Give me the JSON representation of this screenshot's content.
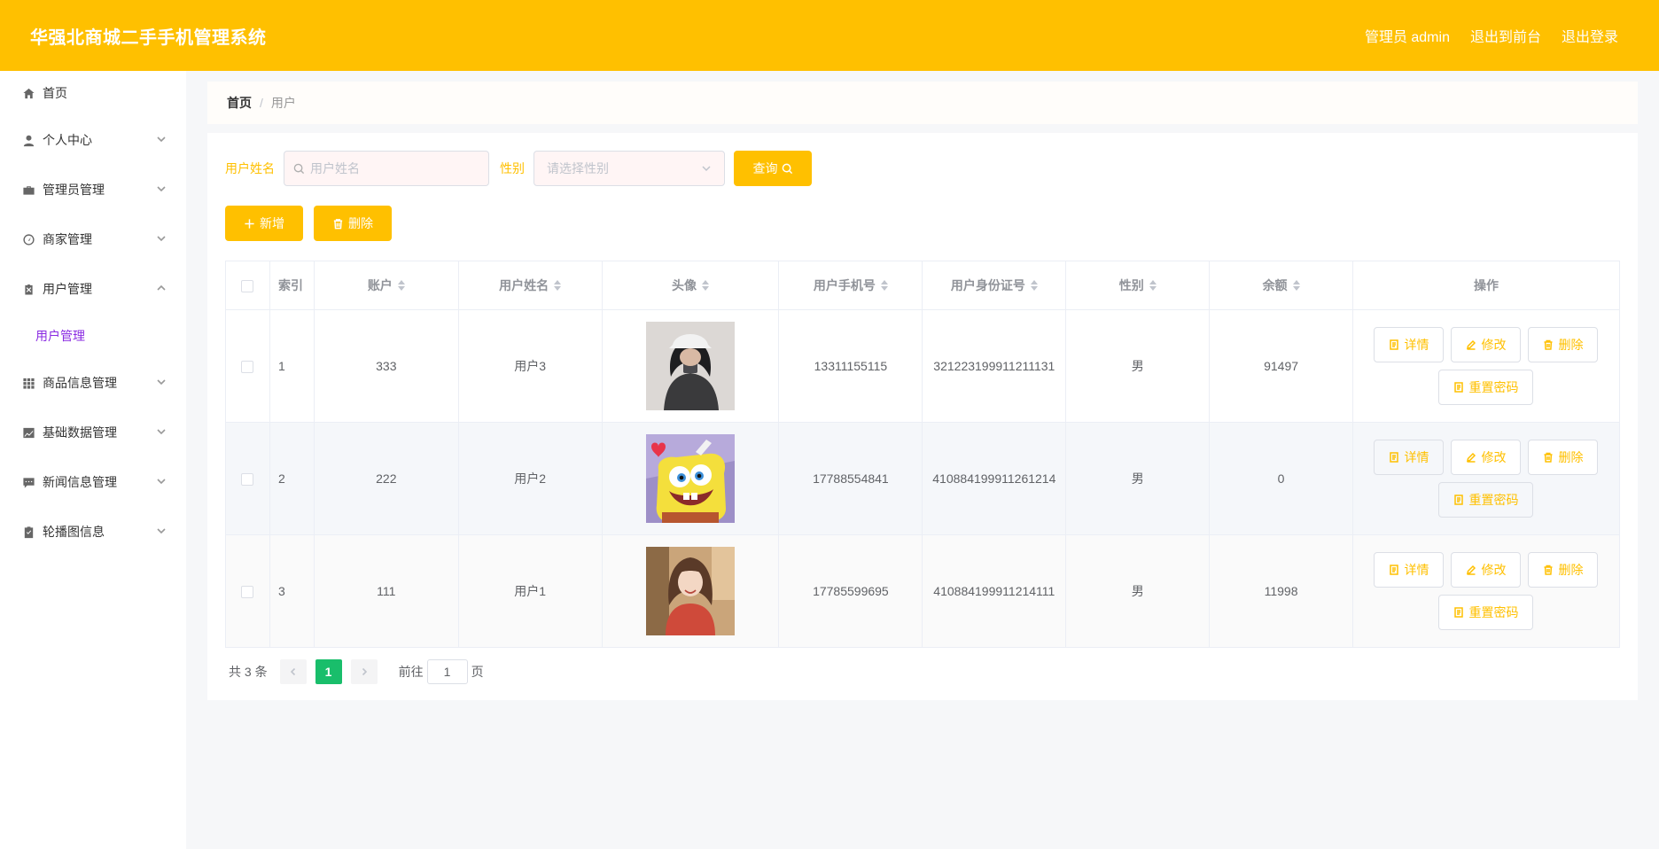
{
  "header": {
    "title": "华强北商城二手手机管理系统",
    "admin_label": "管理员 admin",
    "to_front_label": "退出到前台",
    "logout_label": "退出登录",
    "bg_color": "#ffc000"
  },
  "sidebar": {
    "items": [
      {
        "label": "首页",
        "icon": "home-icon"
      },
      {
        "label": "个人中心",
        "icon": "person-icon"
      },
      {
        "label": "管理员管理",
        "icon": "briefcase-icon"
      },
      {
        "label": "商家管理",
        "icon": "dashboard-icon"
      },
      {
        "label": "用户管理",
        "icon": "clipboard-icon",
        "expanded": true
      },
      {
        "label": "商品信息管理",
        "icon": "grid-icon"
      },
      {
        "label": "基础数据管理",
        "icon": "chart-line-icon"
      },
      {
        "label": "新闻信息管理",
        "icon": "chat-icon"
      },
      {
        "label": "轮播图信息",
        "icon": "check-clipboard-icon"
      }
    ],
    "submenu": {
      "label": "用户管理"
    }
  },
  "breadcrumb": {
    "home": "首页",
    "sep": "/",
    "current": "用户"
  },
  "search": {
    "name_label": "用户姓名",
    "name_placeholder": "用户姓名",
    "gender_label": "性别",
    "gender_placeholder": "请选择性别",
    "query_label": "查询"
  },
  "actions": {
    "add_label": "新增",
    "delete_label": "删除"
  },
  "table": {
    "columns": [
      "索引",
      "账户",
      "用户姓名",
      "头像",
      "用户手机号",
      "用户身份证号",
      "性别",
      "余额",
      "操作"
    ],
    "rows": [
      {
        "index": "1",
        "account": "333",
        "name": "用户3",
        "avatar": "avatar-girl-cap",
        "phone": "13311155115",
        "idcard": "321223199911211131",
        "gender": "男",
        "balance": "91497"
      },
      {
        "index": "2",
        "account": "222",
        "name": "用户2",
        "avatar": "avatar-spongebob",
        "phone": "17788554841",
        "idcard": "410884199911261214",
        "gender": "男",
        "balance": "0"
      },
      {
        "index": "3",
        "account": "111",
        "name": "用户1",
        "avatar": "avatar-girl-red",
        "phone": "17785599695",
        "idcard": "410884199911214111",
        "gender": "男",
        "balance": "11998"
      }
    ],
    "op_labels": {
      "detail": "详情",
      "edit": "修改",
      "delete": "删除",
      "reset": "重置密码"
    }
  },
  "pagination": {
    "total": "共 3 条",
    "current": "1",
    "goto_prefix": "前往",
    "goto_value": "1",
    "goto_suffix": "页"
  }
}
